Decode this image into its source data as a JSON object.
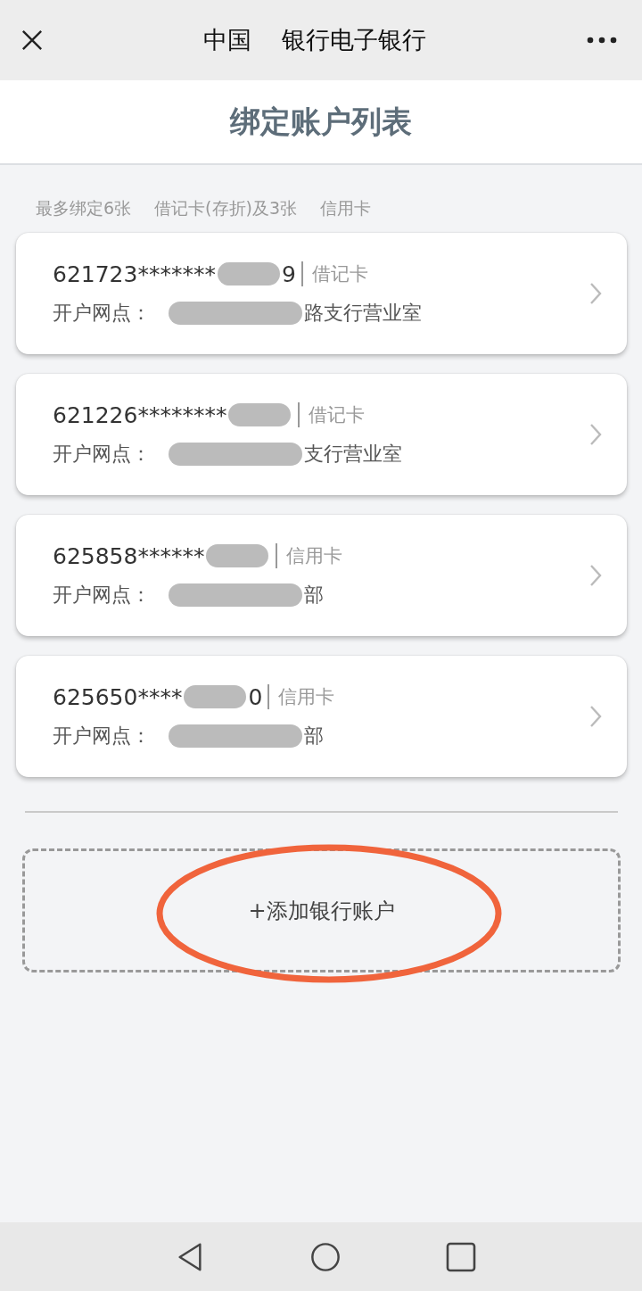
{
  "top_bar": {
    "title_parts": [
      "中国",
      "银行电子银行"
    ]
  },
  "page_title": "绑定账户列表",
  "hint_parts": [
    "最多绑定6张",
    "借记卡(存折)及3张",
    "信用卡"
  ],
  "accounts": [
    {
      "number": "621723*******",
      "number_tail": "9",
      "card_type": "借记卡",
      "branch_label": "开户网点：",
      "branch_tail": "路支行营业室"
    },
    {
      "number": "621226********",
      "card_type": "借记卡",
      "branch_label": "开户网点：",
      "branch_tail": "支行营业室"
    },
    {
      "number": "625858******",
      "card_type": "信用卡",
      "branch_label": "开户网点：",
      "branch_tail": "部"
    },
    {
      "number": "625650****",
      "number_tail": "0",
      "card_type": "信用卡",
      "branch_label": "开户网点：",
      "branch_tail": "部"
    }
  ],
  "add_button": {
    "label": "+添加银行账户",
    "circled": true
  }
}
